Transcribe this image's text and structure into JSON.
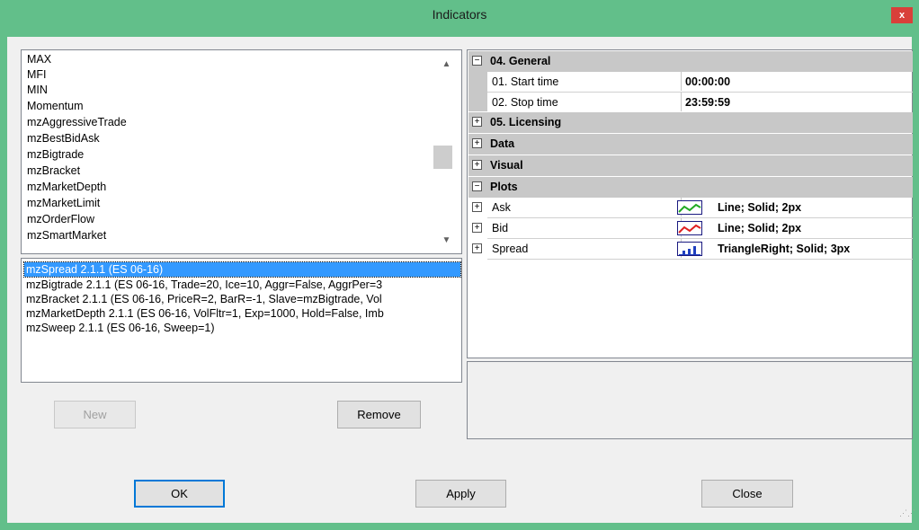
{
  "window": {
    "title": "Indicators",
    "close_label": "x"
  },
  "indicator_list": {
    "items": [
      "MAX",
      "MFI",
      "MIN",
      "Momentum",
      "mzAggressiveTrade",
      "mzBestBidAsk",
      "mzBigtrade",
      "mzBracket",
      "mzMarketDepth",
      "mzMarketLimit",
      "mzOrderFlow",
      "mzSmartMarket"
    ]
  },
  "instance_list": {
    "items": [
      "mzSpread 2.1.1 (ES 06-16)",
      "mzBigtrade 2.1.1 (ES 06-16, Trade=20, Ice=10, Aggr=False, AggrPer=3",
      "mzBracket 2.1.1 (ES 06-16, PriceR=2, BarR=-1, Slave=mzBigtrade, Vol",
      "mzMarketDepth 2.1.1 (ES 06-16, VolFltr=1, Exp=1000, Hold=False, Imb",
      "mzSweep 2.1.1 (ES 06-16, Sweep=1)"
    ]
  },
  "left_buttons": {
    "new": "New",
    "remove": "Remove"
  },
  "property_grid": {
    "general": {
      "label": "04. General",
      "start_name": "01. Start time",
      "start_value": "00:00:00",
      "stop_name": "02. Stop time",
      "stop_value": "23:59:59"
    },
    "licensing": "05. Licensing",
    "data": "Data",
    "visual": "Visual",
    "plots": {
      "label": "Plots",
      "ask_name": "Ask",
      "ask_value": "Line; Solid; 2px",
      "ask_color": "#22aa22",
      "bid_name": "Bid",
      "bid_value": "Line; Solid; 2px",
      "bid_color": "#e02020",
      "spread_name": "Spread",
      "spread_value": "TriangleRight; Solid; 3px",
      "spread_color": "#1f3fbf"
    },
    "expand_glyph": "+",
    "collapse_glyph": "−"
  },
  "footer_buttons": {
    "ok": "OK",
    "apply": "Apply",
    "close": "Close"
  }
}
